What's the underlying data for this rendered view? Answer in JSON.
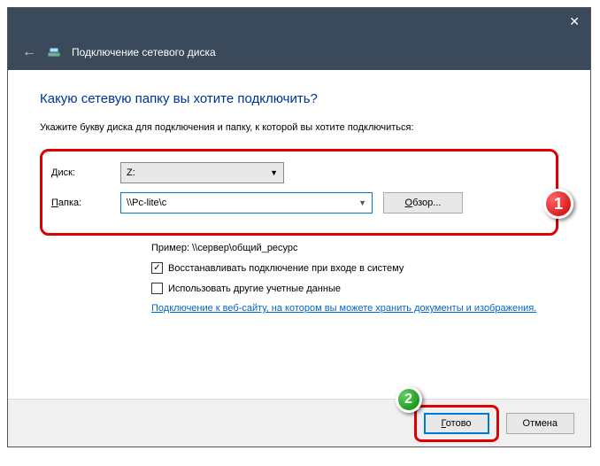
{
  "window": {
    "title": "Подключение сетевого диска"
  },
  "heading": "Какую сетевую папку вы хотите подключить?",
  "instruction": "Укажите букву диска для подключения и папку, к которой вы хотите подключиться:",
  "form": {
    "drive_label": "Диск:",
    "drive_value": "Z:",
    "folder_label": "Папка:",
    "folder_value": "\\\\Pc-lite\\c",
    "browse": "Обзор..."
  },
  "example": "Пример: \\\\сервер\\общий_ресурс",
  "checkboxes": {
    "reconnect": "Восстанавливать подключение при входе в систему",
    "other_creds": "Использовать другие учетные данные"
  },
  "link": "Подключение к веб-сайту, на котором вы можете хранить документы и изображения",
  "buttons": {
    "done": "Готово",
    "cancel": "Отмена"
  },
  "markers": {
    "one": "1",
    "two": "2"
  }
}
